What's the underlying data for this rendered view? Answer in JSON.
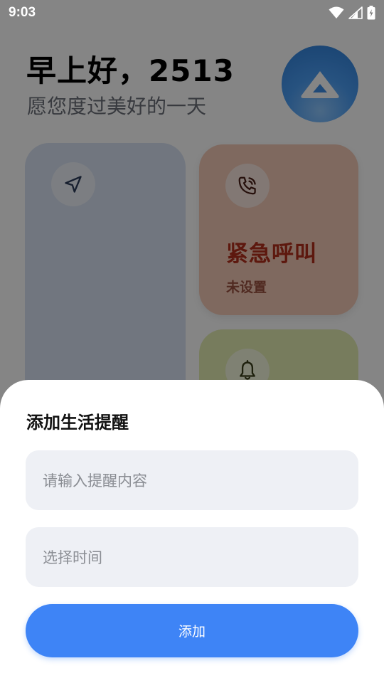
{
  "status_bar": {
    "time": "9:03"
  },
  "header": {
    "greeting": "早上好，2513",
    "subtitle": "愿您度过美好的一天"
  },
  "cards": {
    "emergency": {
      "title": "紧急呼叫",
      "status": "未设置"
    }
  },
  "sheet": {
    "title": "添加生活提醒",
    "content_placeholder": "请输入提醒内容",
    "time_placeholder": "选择时间",
    "add_label": "添加"
  },
  "colors": {
    "accent": "#3e84f6",
    "emergency_card": "#f4c9b6",
    "location_card": "#d8e3f3",
    "reminder_card": "#e4edb3",
    "emergency_text": "#b22f1b"
  },
  "icons": [
    "wifi-icon",
    "signal-icon",
    "battery-icon",
    "navigation-arrow-icon",
    "phone-call-icon",
    "bell-icon",
    "app-logo-icon"
  ]
}
